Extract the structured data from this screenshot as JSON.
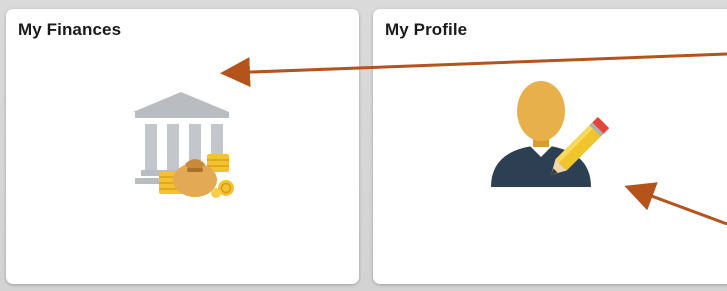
{
  "tiles": [
    {
      "title": "My Finances",
      "icon": "bank-money-icon"
    },
    {
      "title": "My Profile",
      "icon": "user-edit-icon"
    }
  ],
  "colors": {
    "background": "#d8d8d8",
    "tile": "#ffffff",
    "annotation_arrow": "#b5531d",
    "bank_gray": "#b9bcc1",
    "coin_gold": "#f2c230",
    "bag_tan": "#e3a955",
    "avatar_head": "#e8b04b",
    "avatar_body": "#2d3f52",
    "pencil_yellow": "#f0c52c",
    "pencil_tip": "#e2453a"
  }
}
